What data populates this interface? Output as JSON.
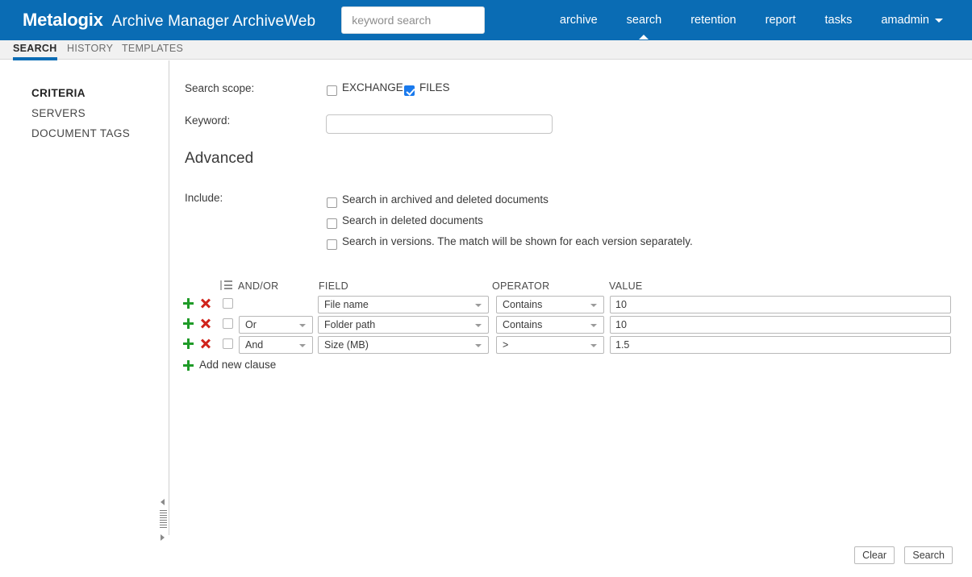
{
  "header": {
    "logo": "Metalogix",
    "app_title": "Archive Manager ArchiveWeb",
    "search_placeholder": "keyword search",
    "nav": [
      {
        "label": "archive",
        "active": false
      },
      {
        "label": "search",
        "active": true
      },
      {
        "label": "retention",
        "active": false
      },
      {
        "label": "report",
        "active": false
      },
      {
        "label": "tasks",
        "active": false
      }
    ],
    "user": "amadmin",
    "user_caret_icon": "chevron-down-icon",
    "brand_color": "#0a6cb4"
  },
  "tabs": [
    {
      "label": "SEARCH",
      "active": true
    },
    {
      "label": "HISTORY",
      "active": false
    },
    {
      "label": "TEMPLATES",
      "active": false
    }
  ],
  "sidebar": {
    "items": [
      {
        "label": "CRITERIA",
        "active": true
      },
      {
        "label": "SERVERS",
        "active": false
      },
      {
        "label": "DOCUMENT TAGS",
        "active": false
      }
    ]
  },
  "main": {
    "scope_label": "Search scope:",
    "scope_options": [
      {
        "label": "EXCHANGE",
        "checked": false
      },
      {
        "label": "FILES",
        "checked": true
      }
    ],
    "keyword_label": "Keyword:",
    "keyword_value": "",
    "advanced_title": "Advanced",
    "include_label": "Include:",
    "include_options": [
      {
        "label": "Search in archived and deleted documents",
        "checked": false
      },
      {
        "label": "Search in deleted documents",
        "checked": false
      },
      {
        "label": "Search in versions. The match will be shown for each version separately.",
        "checked": false
      }
    ],
    "clause_table": {
      "columns": {
        "select_icon": "list-lines-icon",
        "andor": "AND/OR",
        "field": "FIELD",
        "operator": "OPERATOR",
        "value": "VALUE"
      },
      "rows": [
        {
          "selected": false,
          "andor": "",
          "field": "File name",
          "operator": "Contains",
          "value": "10"
        },
        {
          "selected": false,
          "andor": "Or",
          "field": "Folder path",
          "operator": "Contains",
          "value": "10"
        },
        {
          "selected": false,
          "andor": "And",
          "field": "Size (MB)",
          "operator": ">",
          "value": "1.5"
        }
      ],
      "add_clause_label": "Add new clause",
      "add_icon": "plus-icon",
      "row_add_icon": "plus-icon",
      "row_remove_icon": "x-icon"
    },
    "splitter": {
      "collapse_up_icon": "triangle-left-icon",
      "collapse_down_icon": "triangle-right-icon",
      "grip_icon": "grip-handle-icon"
    }
  },
  "footer": {
    "clear_label": "Clear",
    "search_label": "Search"
  }
}
